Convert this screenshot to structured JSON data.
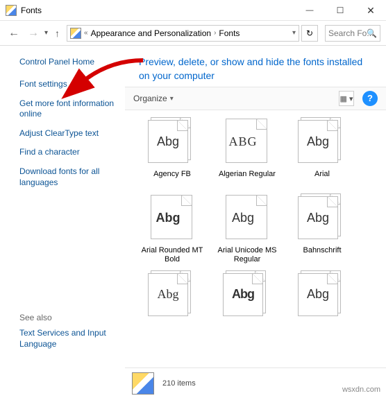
{
  "window": {
    "title": "Fonts"
  },
  "toolbar": {
    "breadcrumb_parent": "Appearance and Personalization",
    "breadcrumb_current": "Fonts",
    "search_placeholder": "Search Fo..."
  },
  "sidebar": {
    "home": "Control Panel Home",
    "links": [
      "Font settings",
      "Get more font information online",
      "Adjust ClearType text",
      "Find a character",
      "Download fonts for all languages"
    ],
    "see_also_header": "See also",
    "see_also_links": [
      "Text Services and Input Language"
    ]
  },
  "content": {
    "heading": "Preview, delete, or show and hide the fonts installed on your computer",
    "organize_label": "Organize",
    "fonts": [
      {
        "name": "Agency FB",
        "sample": "Abg",
        "stack": true,
        "cls": ""
      },
      {
        "name": "Algerian Regular",
        "sample": "ABG",
        "stack": false,
        "cls": "algerian"
      },
      {
        "name": "Arial",
        "sample": "Abg",
        "stack": true,
        "cls": ""
      },
      {
        "name": "Arial Rounded MT Bold",
        "sample": "Abg",
        "stack": false,
        "cls": "bold"
      },
      {
        "name": "Arial Unicode MS Regular",
        "sample": "Abg",
        "stack": false,
        "cls": ""
      },
      {
        "name": "Bahnschrift",
        "sample": "Abg",
        "stack": true,
        "cls": ""
      },
      {
        "name": "",
        "sample": "Abg",
        "stack": true,
        "cls": "serif"
      },
      {
        "name": "",
        "sample": "Abg",
        "stack": true,
        "cls": "bauhaus"
      },
      {
        "name": "",
        "sample": "Abg",
        "stack": true,
        "cls": ""
      }
    ]
  },
  "status": {
    "count_text": "210 items"
  },
  "watermark": "wsxdn.com"
}
